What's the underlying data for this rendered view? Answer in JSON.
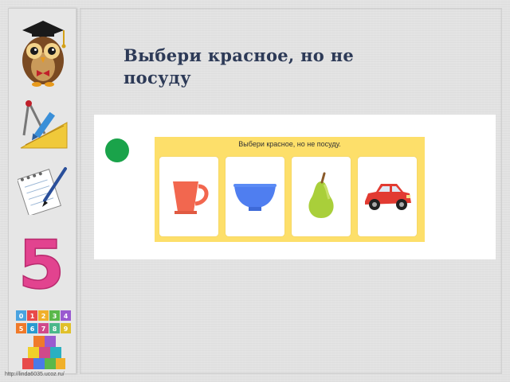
{
  "slide": {
    "title": "Выбери красное, но не посуду"
  },
  "task": {
    "caption": "Выбери красное, но не посуду.",
    "items": [
      {
        "name": "cup",
        "color": "#f2674f"
      },
      {
        "name": "bowl",
        "color": "#4f7ef0"
      },
      {
        "name": "pear",
        "color": "#a9cf3a"
      },
      {
        "name": "car",
        "color": "#e23b32"
      }
    ]
  },
  "sidebar": {
    "number": "5",
    "digit_blocks": [
      "0",
      "1",
      "2",
      "3",
      "4",
      "5",
      "6",
      "7",
      "8",
      "9"
    ]
  },
  "footer": {
    "url": "http://linda6035.ucoz.ru/"
  },
  "colors": {
    "title": "#2d3a57",
    "task_bg": "#fddf6a",
    "dot": "#1aa34a"
  }
}
